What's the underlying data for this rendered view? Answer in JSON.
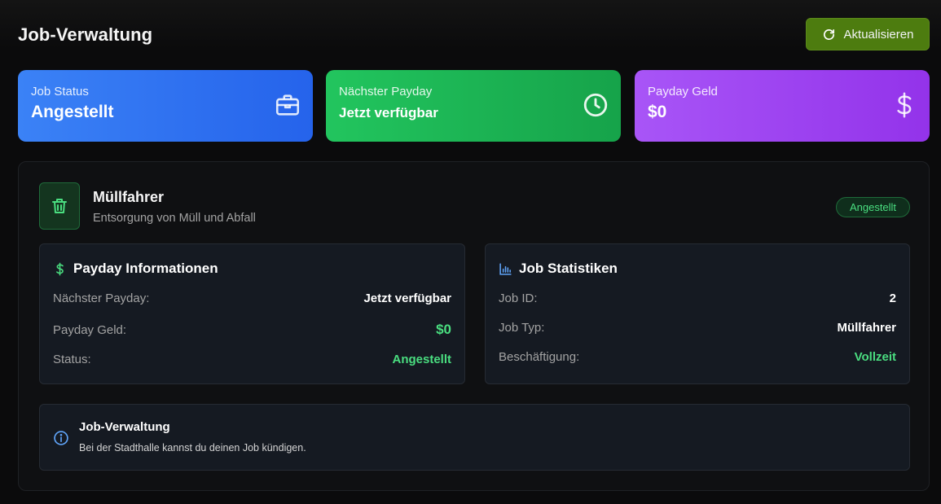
{
  "header": {
    "title": "Job-Verwaltung",
    "refresh_label": "Aktualisieren"
  },
  "cards": {
    "job_status": {
      "label": "Job Status",
      "value": "Angestellt",
      "icon": "briefcase-icon",
      "color": "#3b82f6"
    },
    "next_payday": {
      "label": "Nächster Payday",
      "value": "Jetzt verfügbar",
      "icon": "clock-icon",
      "color": "#22c55e"
    },
    "payday_money": {
      "label": "Payday Geld",
      "value": "$0",
      "icon": "dollar-icon",
      "color": "#a855f7"
    }
  },
  "job": {
    "name": "Müllfahrer",
    "description": "Entsorgung von Müll und Abfall",
    "status_badge": "Angestellt",
    "icon": "trash-icon"
  },
  "payday_info": {
    "title": "Payday Informationen",
    "rows": [
      {
        "key": "Nächster Payday:",
        "value": "Jetzt verfügbar"
      },
      {
        "key": "Payday Geld:",
        "value": "$0"
      },
      {
        "key": "Status:",
        "value": "Angestellt"
      }
    ]
  },
  "job_stats": {
    "title": "Job Statistiken",
    "rows": [
      {
        "key": "Job ID:",
        "value": "2"
      },
      {
        "key": "Job Typ:",
        "value": "Müllfahrer"
      },
      {
        "key": "Beschäftigung:",
        "value": "Vollzeit"
      }
    ]
  },
  "note": {
    "title": "Job-Verwaltung",
    "text": "Bei der Stadthalle kannst du deinen Job kündigen."
  },
  "colors": {
    "accent_green": "#4ade80",
    "button_green": "#4d7c0f"
  }
}
